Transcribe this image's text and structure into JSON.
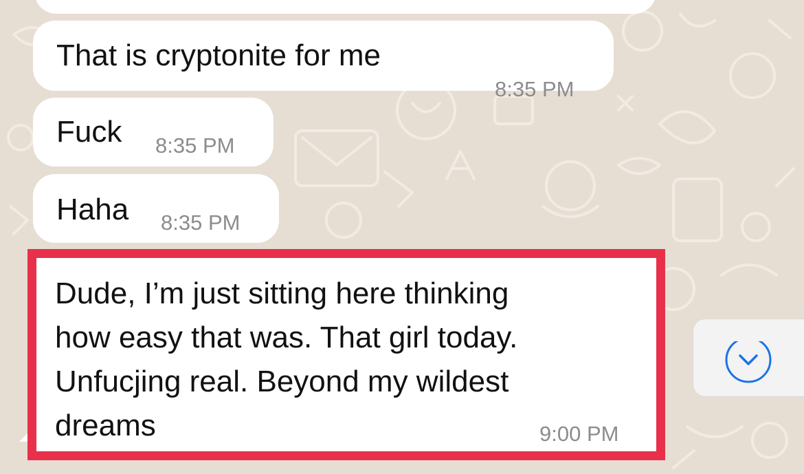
{
  "messages": [
    {
      "text": "",
      "time": ""
    },
    {
      "text": "That is cryptonite for me",
      "time": "8:35 PM"
    },
    {
      "text": "Fuck",
      "time": "8:35 PM"
    },
    {
      "text": "Haha",
      "time": "8:35 PM"
    }
  ],
  "highlighted_message": {
    "text": "Dude, I’m just sitting here thinking\nhow easy that was. That girl today.\nUnfucjing real. Beyond my wildest\ndreams",
    "time": "9:00 PM"
  },
  "scroll_button": {
    "icon": "chevron-down-icon"
  },
  "colors": {
    "wallpaper": "#e6ded3",
    "bubble": "#ffffff",
    "highlight_border": "#e8304a",
    "timestamp": "#8c8c8c",
    "scroll_icon": "#1a73e8"
  }
}
